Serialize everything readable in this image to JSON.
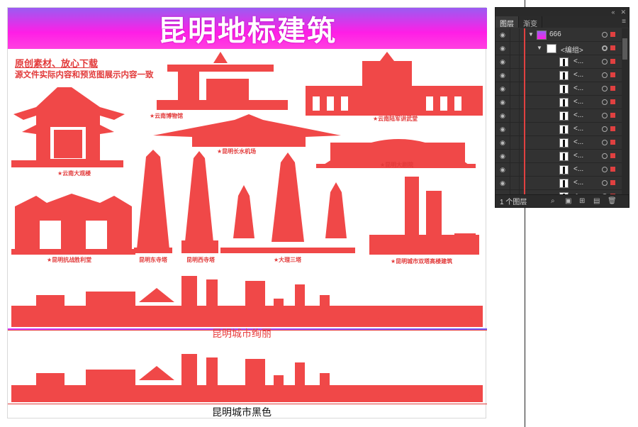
{
  "artboard": {
    "banner_title": "昆明地标建筑",
    "note_line1": "原创素材、放心下载",
    "note_line2": "源文件实际内容和预览图展示内容一致",
    "captions": {
      "c1": "★云南博物馆",
      "c2": "★云南陆军讲武堂",
      "c3": "★昆明长水机场",
      "c4": "★云南大观楼",
      "c5": "★昆明大剧院",
      "c6": "★昆明抗战胜利堂",
      "c7": "昆明东寺塔",
      "c8": "昆明西寺塔",
      "c9": "★大理三塔",
      "c10": "★昆明城市双塔高楼建筑"
    },
    "skyline_label_red": "昆明城市绚丽",
    "skyline_label_black": "昆明城市黑色"
  },
  "colors": {
    "silhouette": "#f04848",
    "banner_top": "#9a5cf2",
    "banner_bottom": "#ff1ee6"
  },
  "layers_panel": {
    "tabs": [
      "图层",
      "渐变"
    ],
    "rows": [
      {
        "level": "layer",
        "name": "666"
      },
      {
        "level": "group",
        "name": "<编组>"
      },
      {
        "level": "item",
        "name": "<..."
      },
      {
        "level": "item",
        "name": "<..."
      },
      {
        "level": "item",
        "name": "<..."
      },
      {
        "level": "item",
        "name": "<..."
      },
      {
        "level": "item",
        "name": "<..."
      },
      {
        "level": "item",
        "name": "<..."
      },
      {
        "level": "item",
        "name": "<..."
      },
      {
        "level": "item",
        "name": "<..."
      },
      {
        "level": "item",
        "name": "<..."
      },
      {
        "level": "item",
        "name": "<..."
      },
      {
        "level": "item",
        "name": "<..."
      }
    ],
    "footer_count": "1 个图层",
    "icons": [
      "eye-icon",
      "search-icon",
      "new-sublayer-icon",
      "new-layer-icon",
      "trash-icon"
    ]
  }
}
